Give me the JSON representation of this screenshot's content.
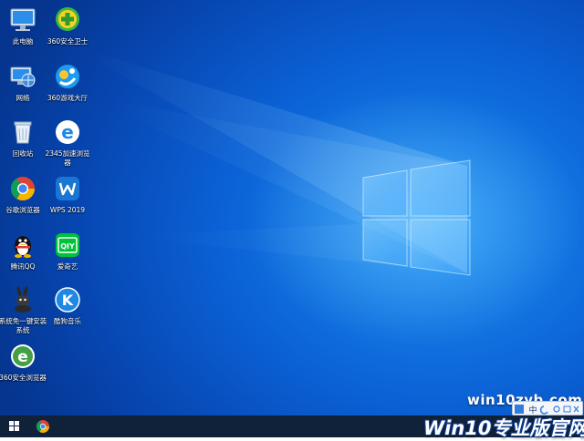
{
  "desktop": {
    "icons": [
      {
        "label": "此电脑",
        "icon": "computer-icon"
      },
      {
        "label": "360安全卫士",
        "icon": "360-security-icon"
      },
      {
        "label": "网络",
        "icon": "network-icon"
      },
      {
        "label": "360游戏大厅",
        "icon": "360-game-hall-icon"
      },
      {
        "label": "回收站",
        "icon": "recycle-bin-icon"
      },
      {
        "label": "2345加速浏览器",
        "icon": "ie-browser-icon"
      },
      {
        "label": "谷歌浏览器",
        "icon": "chrome-icon"
      },
      {
        "label": "WPS 2019",
        "icon": "wps-icon"
      },
      {
        "label": "腾讯QQ",
        "icon": "qq-penguin-icon"
      },
      {
        "label": "爱奇艺",
        "icon": "iqiyi-icon"
      },
      {
        "label": "系统免一键安装系统",
        "icon": "rabbit-icon"
      },
      {
        "label": "酷狗音乐",
        "icon": "kugou-icon"
      },
      {
        "label": "360安全浏览器",
        "icon": "360-browser-icon"
      }
    ]
  },
  "watermark": {
    "site": "win10zyb.com",
    "brand": "Win10专业版官网"
  },
  "taskbar": {
    "start_icon": "windows-start-icon",
    "pinned": [
      "chrome-icon"
    ]
  },
  "ime": {
    "label": "中"
  },
  "colors": {
    "desktop_blue": "#0b62d6",
    "taskbar": "#10223a"
  }
}
